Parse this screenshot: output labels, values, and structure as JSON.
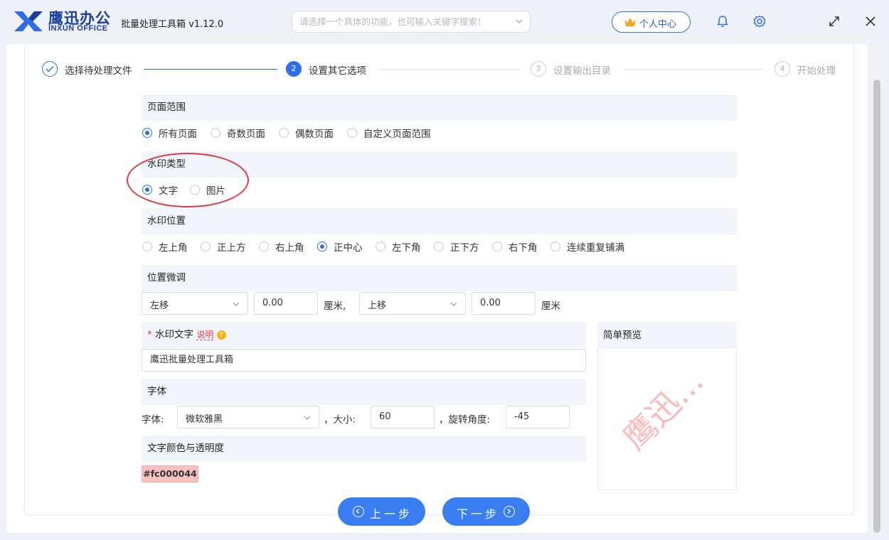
{
  "header": {
    "brand_cn": "鹰迅办公",
    "brand_en": "INXUN OFFICE",
    "app_name": "批量处理工具箱 v1.12.0",
    "search_placeholder": "请选择一个具体的功能，也可输入关键字搜索！",
    "user_center": "个人中心",
    "accent": "#2f6ee8"
  },
  "steps": [
    {
      "num": "1",
      "label": "选择待处理文件",
      "state": "done"
    },
    {
      "num": "2",
      "label": "设置其它选项",
      "state": "active"
    },
    {
      "num": "3",
      "label": "设置输出目录",
      "state": "pending"
    },
    {
      "num": "4",
      "label": "开始处理",
      "state": "pending"
    }
  ],
  "page_range": {
    "title": "页面范围",
    "options": [
      "所有页面",
      "奇数页面",
      "偶数页面",
      "自定义页面范围"
    ],
    "selected": 0
  },
  "watermark_type": {
    "title": "水印类型",
    "options": [
      "文字",
      "图片"
    ],
    "selected": 0
  },
  "watermark_position": {
    "title": "水印位置",
    "options": [
      "左上角",
      "正上方",
      "右上角",
      "正中心",
      "左下角",
      "正下方",
      "右下角",
      "连续重复铺满"
    ],
    "selected": 3
  },
  "fine_tune": {
    "title": "位置微调",
    "h_direction": "左移",
    "h_value": "0.00",
    "unit_h": "厘米,",
    "v_direction": "上移",
    "v_value": "0.00",
    "unit_v": "厘米"
  },
  "watermark_text": {
    "required_mark": "*",
    "title": "水印文字",
    "help": "说明",
    "value": "鹰迅批量处理工具箱"
  },
  "font": {
    "title": "字体",
    "font_label": "字体:",
    "font_value": "微软雅黑",
    "size_label": "，大小:",
    "size_value": "60",
    "rotate_label": "，旋转角度:",
    "rotate_value": "-45"
  },
  "color": {
    "title": "文字颜色与透明度",
    "value": "#fc000044"
  },
  "preview": {
    "title": "简单预览",
    "sample": "鹰迅..."
  },
  "nav": {
    "prev": "上一步",
    "next": "下一步"
  }
}
